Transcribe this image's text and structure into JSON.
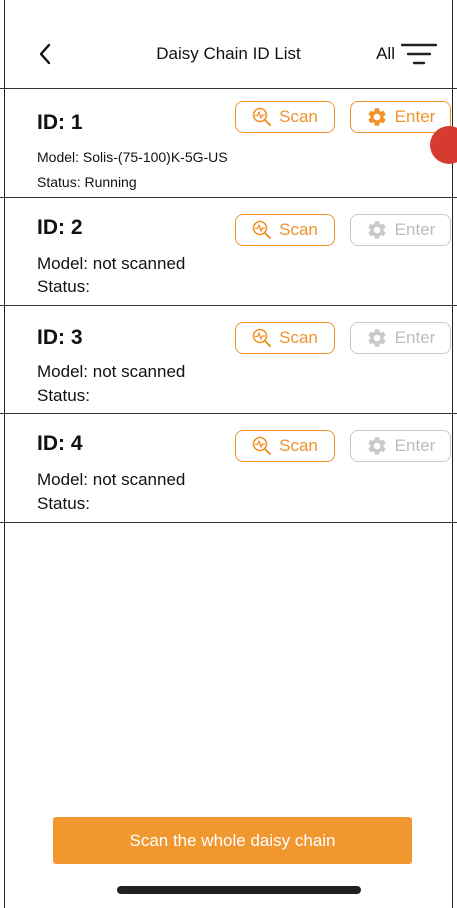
{
  "header": {
    "title": "Daisy Chain ID List",
    "filter_label": "All"
  },
  "rows": [
    {
      "id_label": "ID: 1",
      "model": "Model: Solis-(75-100)K-5G-US",
      "status": "Status: Running",
      "scan_label": "Scan",
      "enter_label": "Enter",
      "enter_enabled": true
    },
    {
      "id_label": "ID: 2",
      "model": "Model: not scanned",
      "status": "Status:",
      "scan_label": "Scan",
      "enter_label": "Enter",
      "enter_enabled": false
    },
    {
      "id_label": "ID: 3",
      "model": "Model: not scanned",
      "status": "Status:",
      "scan_label": "Scan",
      "enter_label": "Enter",
      "enter_enabled": false
    },
    {
      "id_label": "ID: 4",
      "model": "Model: not scanned",
      "status": "Status:",
      "scan_label": "Scan",
      "enter_label": "Enter",
      "enter_enabled": false
    }
  ],
  "footer": {
    "scan_all_label": "Scan the whole daisy chain"
  },
  "colors": {
    "accent": "#f0932b",
    "disabled": "#c9c9c9",
    "dot": "#d63b2f"
  },
  "icons": [
    "back-chevron-icon",
    "filter-icon",
    "scan-search-icon",
    "gear-icon"
  ]
}
